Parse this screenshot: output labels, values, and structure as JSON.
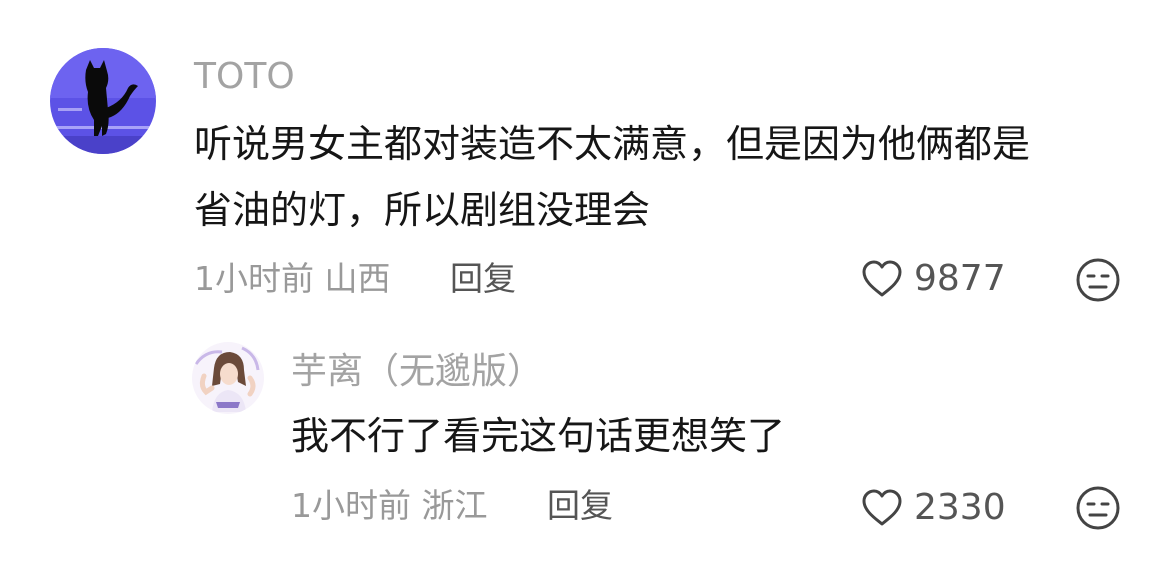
{
  "comments": [
    {
      "username": "TOTO",
      "avatar_icon": "black-cat-avatar",
      "content_lines": [
        "听说男女主都对装造不太满意，但是因为他俩都是",
        "省油的灯，所以剧组没理会"
      ],
      "meta": "1小时前 山西",
      "reply_label": "回复",
      "like_count": "9877",
      "like_icon": "heart-outline-icon",
      "dislike_icon": "meh-face-icon"
    },
    {
      "username": "芋离（无邈版）",
      "avatar_icon": "anime-girl-avatar",
      "content_lines": [
        "我不行了看完这句话更想笑了"
      ],
      "meta": "1小时前 浙江",
      "reply_label": "回复",
      "like_count": "2330",
      "like_icon": "heart-outline-icon",
      "dislike_icon": "meh-face-icon"
    }
  ],
  "colors": {
    "username": "#a3a3a3",
    "content": "#161616",
    "meta": "#999999",
    "action": "#555555",
    "avatar_bg": "#5a4fe0"
  }
}
